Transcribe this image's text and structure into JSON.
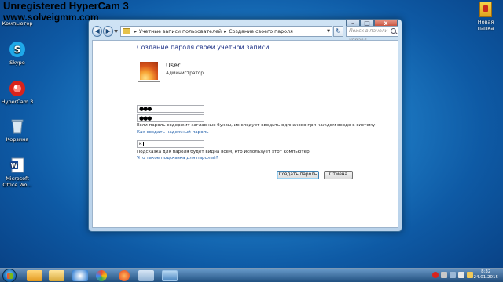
{
  "watermark": {
    "line1": "Unregistered HyperCam 3",
    "line2": "www.solveigmm.com"
  },
  "desktop": {
    "icons": [
      {
        "label": "Компьютер"
      },
      {
        "label": "Skype"
      },
      {
        "label": "HyperCam 3"
      },
      {
        "label": "Корзина"
      },
      {
        "label": "Microsoft Office Wo..."
      }
    ],
    "right_icon": {
      "label": "Новая папка"
    }
  },
  "window": {
    "breadcrumb": [
      "Учетные записи пользователей",
      "Создание своего пароля"
    ],
    "search_placeholder": "Поиск в панели управл...",
    "heading": "Создание пароля своей учетной записи",
    "user": {
      "name": "User",
      "role": "Администратор"
    },
    "password_value": "●●●",
    "confirm_value": "●●●",
    "note_caps": "Если пароль содержит заглавные буквы, их следует вводить одинаково при каждом входе в систему.",
    "link_strong": "Как создать надежный пароль",
    "hint_value": "к",
    "note_hint": "Подсказка для пароля будет видна всем, кто использует этот компьютер.",
    "link_hint": "Что такое подсказка для паролей?",
    "create_button": "Создать пароль",
    "cancel_button": "Отмена"
  },
  "taskbar": {
    "time": "8:32",
    "date": "24.01.2015"
  }
}
